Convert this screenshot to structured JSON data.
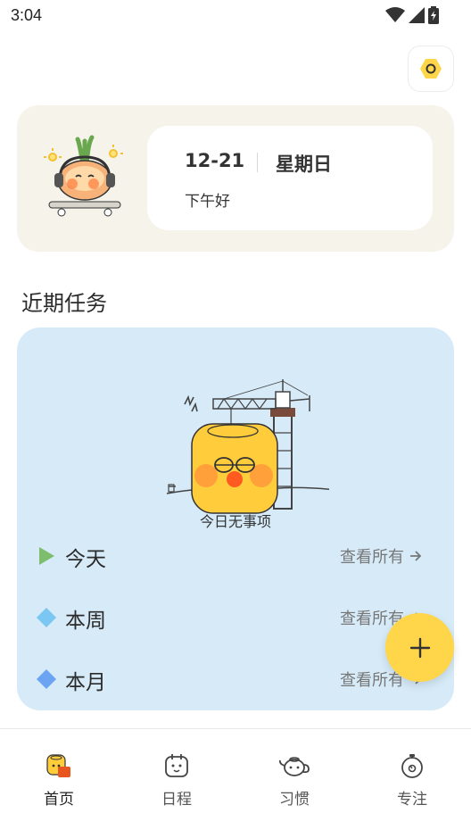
{
  "status_bar": {
    "time": "3:04",
    "icons": [
      "wifi-icon",
      "signal-icon",
      "battery-icon"
    ]
  },
  "header": {
    "settings_icon": "hexagon-settings-icon"
  },
  "greeting_card": {
    "date": "12-21",
    "weekday": "星期日",
    "greeting": "下午好"
  },
  "tasks": {
    "section_title": "近期任务",
    "empty_text": "今日无事项",
    "rows": [
      {
        "label": "今天",
        "link": "查看所有",
        "icon": "play-triangle-icon",
        "color": "#7cbd6e"
      },
      {
        "label": "本周",
        "link": "查看所有",
        "icon": "diamond-icon",
        "color": "#79c7f2"
      },
      {
        "label": "本月",
        "link": "查看所有",
        "icon": "diamond-icon",
        "color": "#6aa4f3"
      }
    ]
  },
  "fab": {
    "icon": "plus-icon",
    "color": "#ffd54a"
  },
  "bottom_nav": {
    "items": [
      {
        "label": "首页",
        "icon": "home-mascot-icon",
        "active": true
      },
      {
        "label": "日程",
        "icon": "calendar-face-icon",
        "active": false
      },
      {
        "label": "习惯",
        "icon": "teapot-icon",
        "active": false
      },
      {
        "label": "专注",
        "icon": "stopwatch-icon",
        "active": false
      }
    ]
  },
  "colors": {
    "greeting_bg": "#f6f3ea",
    "tasks_bg": "#d6eaf8",
    "accent": "#ffd54a"
  }
}
